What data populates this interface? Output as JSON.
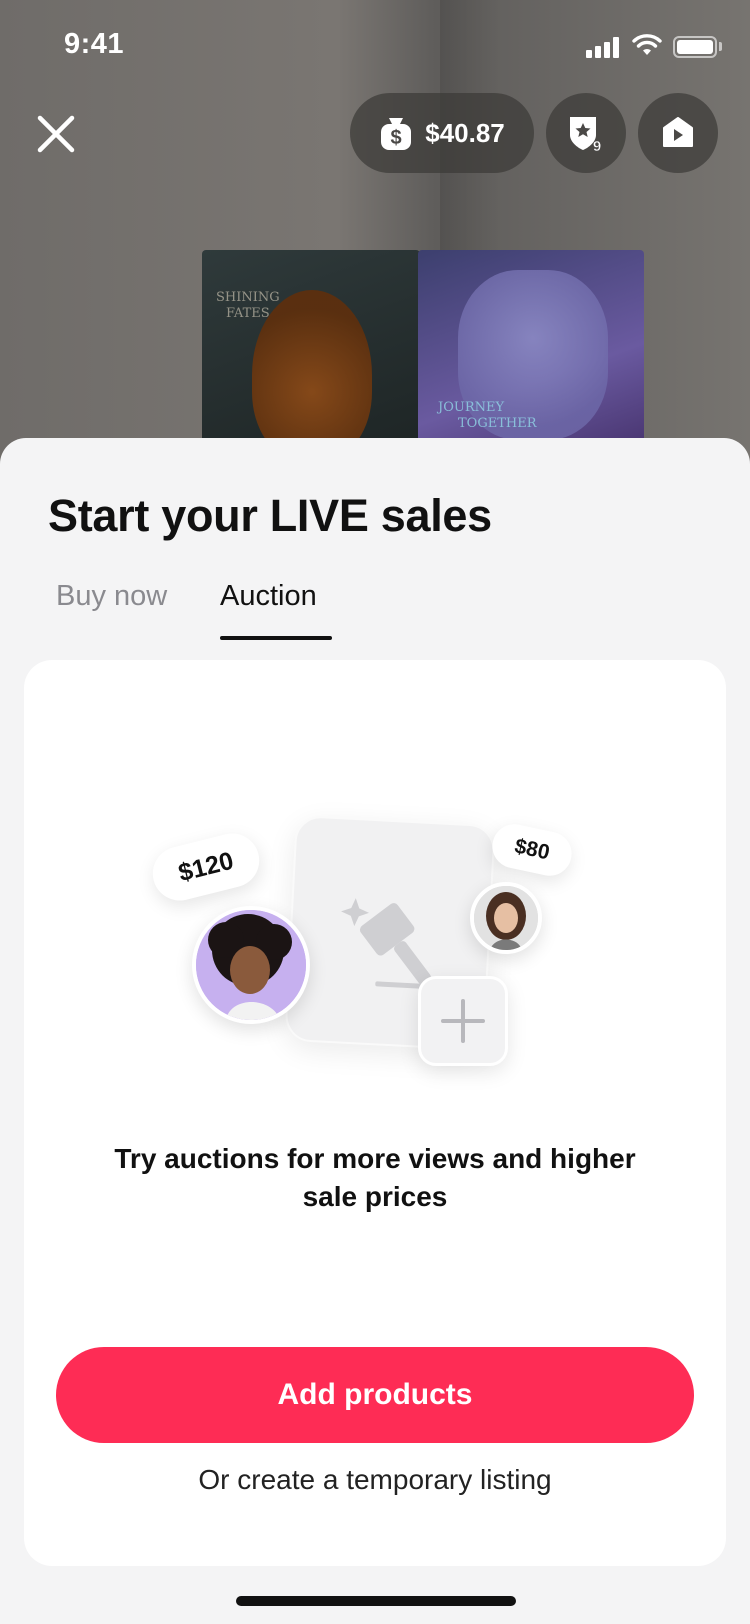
{
  "status_bar": {
    "time": "9:41"
  },
  "top_bar": {
    "balance": "$40.87",
    "badge_count": "9"
  },
  "sheet": {
    "title": "Start your LIVE sales",
    "tabs": [
      {
        "label": "Buy now",
        "active": false
      },
      {
        "label": "Auction",
        "active": true
      }
    ],
    "illustration": {
      "bid_high": "$120",
      "bid_low": "$80"
    },
    "caption": "Try auctions for more views and higher sale prices",
    "primary_button": "Add products",
    "secondary_link": "Or create a temporary listing"
  },
  "background_boxes": {
    "left_lines": [
      "SHINING",
      "FATES"
    ],
    "right_lines": [
      "JOURNEY",
      "TOGETHER"
    ]
  },
  "colors": {
    "accent": "#fe2c55",
    "sheet_bg": "#f4f4f5",
    "card_bg": "#ffffff"
  }
}
